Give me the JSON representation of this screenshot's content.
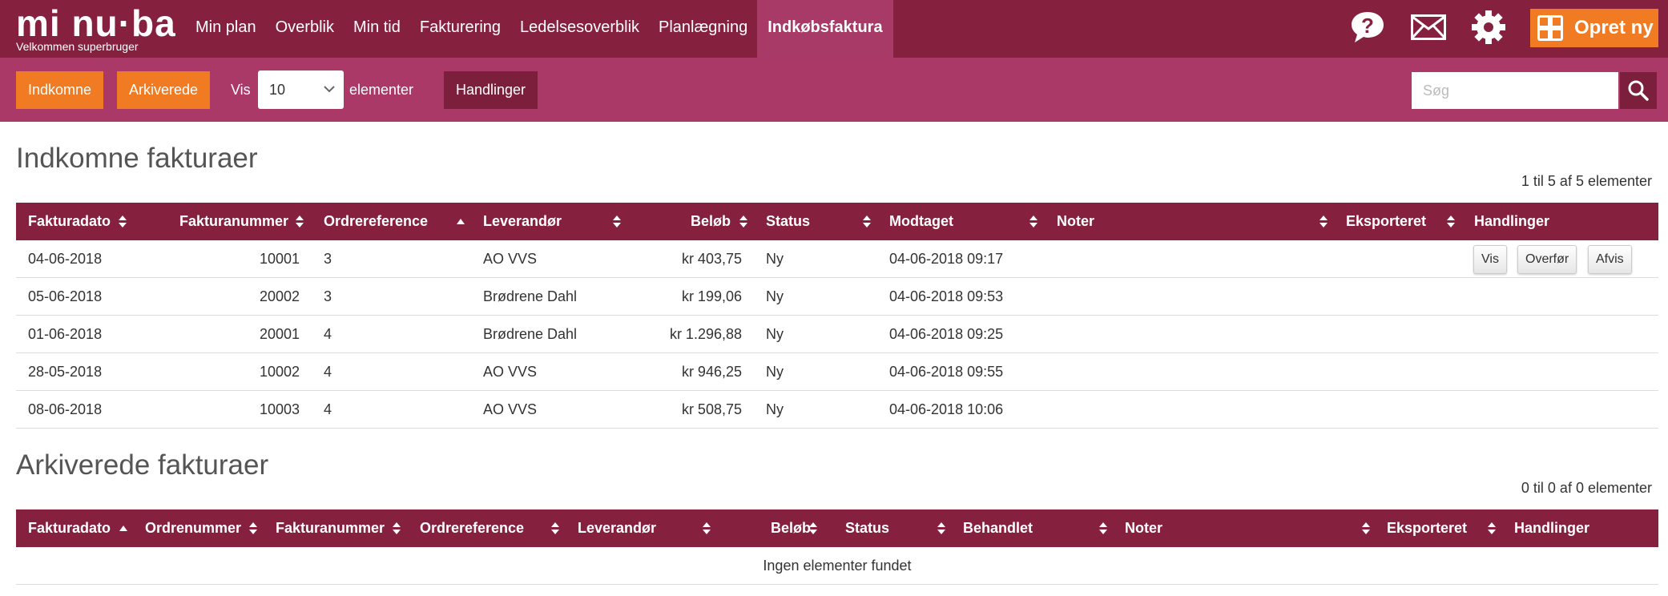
{
  "app": {
    "logo_text": "mi nu·ba",
    "logo_subtitle": "Velkommen superbruger",
    "colors": {
      "brand": "#85213f",
      "toolbar": "#ab3967",
      "accent": "#f07b22"
    }
  },
  "nav": {
    "items": [
      {
        "label": "Min plan",
        "active": false
      },
      {
        "label": "Overblik",
        "active": false
      },
      {
        "label": "Min tid",
        "active": false
      },
      {
        "label": "Fakturering",
        "active": false
      },
      {
        "label": "Ledelsesoverblik",
        "active": false
      },
      {
        "label": "Planlægning",
        "active": false
      },
      {
        "label": "Indkøbsfaktura",
        "active": true
      }
    ],
    "icons": [
      "help-icon",
      "mail-icon",
      "gear-icon"
    ],
    "create_label": "Opret ny"
  },
  "toolbar": {
    "incoming_label": "Indkomne",
    "archived_label": "Arkiverede",
    "show_label": "Vis",
    "page_size_value": "10",
    "elements_label": "elementer",
    "actions_label": "Handlinger",
    "search_placeholder": "Søg"
  },
  "incoming": {
    "title": "Indkomne fakturaer",
    "count_text": "1 til 5 af 5 elementer",
    "columns": [
      "Fakturadato",
      "Fakturanummer",
      "Ordrereference",
      "Leverandør",
      "Beløb",
      "Status",
      "Modtaget",
      "Noter",
      "Eksporteret",
      "Handlinger"
    ],
    "sorted_column": "Ordrereference",
    "rows": [
      {
        "date": "04-06-2018",
        "number": "10001",
        "ref": "3",
        "supplier": "AO VVS",
        "amount": "kr 403,75",
        "status": "Ny",
        "received": "04-06-2018 09:17",
        "notes": "",
        "exported": ""
      },
      {
        "date": "05-06-2018",
        "number": "20002",
        "ref": "3",
        "supplier": "Brødrene Dahl",
        "amount": "kr 199,06",
        "status": "Ny",
        "received": "04-06-2018 09:53",
        "notes": "",
        "exported": ""
      },
      {
        "date": "01-06-2018",
        "number": "20001",
        "ref": "4",
        "supplier": "Brødrene Dahl",
        "amount": "kr 1.296,88",
        "status": "Ny",
        "received": "04-06-2018 09:25",
        "notes": "",
        "exported": ""
      },
      {
        "date": "28-05-2018",
        "number": "10002",
        "ref": "4",
        "supplier": "AO VVS",
        "amount": "kr 946,25",
        "status": "Ny",
        "received": "04-06-2018 09:55",
        "notes": "",
        "exported": ""
      },
      {
        "date": "08-06-2018",
        "number": "10003",
        "ref": "4",
        "supplier": "AO VVS",
        "amount": "kr 508,75",
        "status": "Ny",
        "received": "04-06-2018 10:06",
        "notes": "",
        "exported": ""
      }
    ],
    "row_actions": {
      "view": "Vis",
      "transfer": "Overfør",
      "reject": "Afvis"
    }
  },
  "archived": {
    "title": "Arkiverede fakturaer",
    "count_text": "0 til 0 af 0 elementer",
    "columns": [
      "Fakturadato",
      "Ordrenummer",
      "Fakturanummer",
      "Ordrereference",
      "Leverandør",
      "Beløb",
      "Status",
      "Behandlet",
      "Noter",
      "Eksporteret",
      "Handlinger"
    ],
    "sorted_column": "Fakturadato",
    "empty_message": "Ingen elementer fundet"
  }
}
